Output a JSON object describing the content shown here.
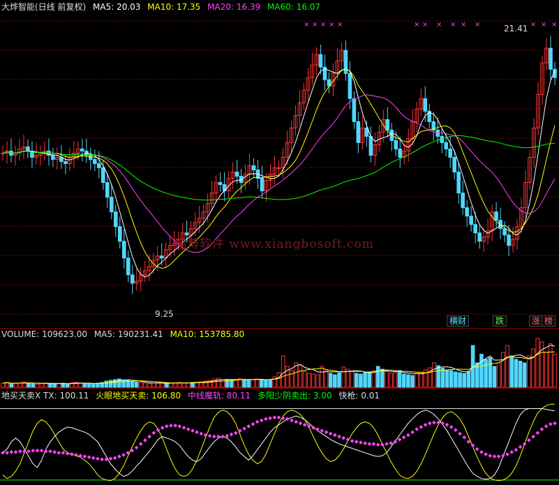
{
  "main_pane": {
    "title": "大烨智能(日线 前复权)",
    "ma_labels": [
      {
        "text": "MA5: 20.03",
        "color": "#ffffff"
      },
      {
        "text": "MA10: 17.35",
        "color": "#ffff00"
      },
      {
        "text": "MA20: 16.39",
        "color": "#ff44ff"
      },
      {
        "text": "MA60: 16.07",
        "color": "#00ff00"
      }
    ],
    "high_label": "21.41",
    "low_label": "9.25",
    "watermark": "翔博软件 www.xiangbosoft.com",
    "badges": [
      {
        "text": "横财",
        "color": "#4fd8ff"
      },
      {
        "text": "跌",
        "color": "#44ff44"
      },
      {
        "text": "涨",
        "color": "#ff6666"
      },
      {
        "text": "榜",
        "color": "#ff6666"
      }
    ]
  },
  "volume_pane": {
    "labels": [
      {
        "text": "VOLUME: 109623.00",
        "color": "#dddddd"
      },
      {
        "text": "MA5: 190231.41",
        "color": "#dddddd"
      },
      {
        "text": "MA10: 153785.80",
        "color": "#ffff00"
      }
    ]
  },
  "indicator_pane": {
    "labels": [
      {
        "text": "地买天卖X TX: 100.11",
        "color": "#dddddd"
      },
      {
        "text": "火眼地买天卖: 106.80",
        "color": "#ffff00"
      },
      {
        "text": "中线魔轨: 80.11",
        "color": "#ff44ff"
      },
      {
        "text": "多阳少阴卖出: 3.00",
        "color": "#00ff00"
      },
      {
        "text": "快枪: 0.01",
        "color": "#dddddd"
      }
    ]
  },
  "colors": {
    "up": "#ff3333",
    "down": "#4fd8ff",
    "ma5": "#ffffff",
    "ma10": "#ffff00",
    "ma20": "#ff44ff",
    "ma60": "#00ff00",
    "grid": "#8a0000"
  },
  "chart_data": [
    {
      "type": "candlestick",
      "title": "大烨智能(日线 前复权)",
      "ylim": [
        8.0,
        22.5
      ],
      "annotations": [
        "21.41",
        "9.25"
      ],
      "close": [
        16.0,
        16.1,
        15.9,
        16.0,
        16.2,
        16.3,
        16.1,
        15.8,
        15.9,
        16.0,
        16.1,
        15.9,
        15.7,
        15.8,
        15.6,
        15.5,
        15.8,
        16.0,
        16.2,
        16.1,
        15.9,
        15.7,
        15.5,
        15.3,
        14.6,
        13.9,
        13.2,
        12.5,
        11.8,
        11.0,
        10.2,
        9.8,
        9.9,
        10.2,
        10.4,
        10.6,
        10.9,
        11.1,
        11.0,
        11.4,
        11.6,
        11.7,
        11.9,
        12.2,
        12.1,
        12.4,
        12.7,
        12.9,
        13.2,
        13.6,
        14.1,
        14.6,
        14.5,
        14.2,
        14.8,
        15.1,
        14.9,
        14.6,
        15.0,
        15.4,
        15.2,
        14.8,
        14.2,
        14.7,
        15.0,
        15.3,
        15.3,
        15.8,
        16.5,
        17.2,
        17.8,
        18.4,
        19.0,
        19.6,
        20.2,
        20.7,
        20.1,
        19.5,
        19.2,
        19.8,
        20.4,
        20.9,
        19.8,
        18.6,
        17.5,
        16.5,
        17.2,
        16.8,
        15.9,
        16.4,
        17.0,
        17.6,
        17.1,
        16.6,
        16.2,
        15.8,
        16.1,
        16.7,
        17.5,
        18.1,
        18.6,
        18.0,
        17.5,
        17.1,
        16.8,
        16.5,
        16.2,
        15.8,
        15.1,
        14.1,
        13.4,
        13.0,
        12.6,
        12.2,
        11.8,
        12.0,
        12.3,
        13.2,
        12.8,
        12.4,
        12.1,
        11.6,
        11.9,
        12.5,
        13.4,
        14.6,
        15.8,
        17.2,
        18.8,
        20.3,
        21.0,
        20.0,
        19.6
      ],
      "ma_legend": {
        "MA5": 20.03,
        "MA10": 17.35,
        "MA20": 16.39,
        "MA60": 16.07
      }
    },
    {
      "type": "bar",
      "title": "VOLUME",
      "values": [
        12,
        14,
        10,
        11,
        13,
        15,
        12,
        10,
        9,
        11,
        12,
        10,
        9,
        11,
        12,
        10,
        13,
        14,
        12,
        11,
        10,
        9,
        12,
        14,
        18,
        20,
        22,
        24,
        21,
        19,
        17,
        15,
        13,
        12,
        11,
        12,
        13,
        12,
        11,
        12,
        13,
        14,
        12,
        13,
        14,
        15,
        16,
        18,
        20,
        24,
        26,
        22,
        21,
        20,
        22,
        25,
        23,
        20,
        22,
        24,
        23,
        21,
        22,
        30,
        42,
        90,
        60,
        48,
        70,
        62,
        45,
        40,
        38,
        36,
        60,
        48,
        40,
        36,
        42,
        58,
        52,
        46,
        40,
        38,
        42,
        44,
        48,
        60,
        52,
        45,
        40,
        42,
        48,
        38,
        36,
        34,
        40,
        44,
        50,
        56,
        70,
        62,
        55,
        50,
        48,
        44,
        42,
        40,
        46,
        120,
        70,
        95,
        80,
        85,
        60,
        70,
        100,
        120,
        90,
        80,
        75,
        70,
        90,
        110,
        140,
        130,
        100,
        125,
        95
      ],
      "ma_legend": {
        "MA5": 190231.41,
        "MA10": 153785.8
      },
      "last_volume": 109623.0
    },
    {
      "type": "line",
      "title": "地买天卖X",
      "series": [
        {
          "name": "TX",
          "values": [
            40,
            45,
            55,
            60,
            55,
            45,
            35,
            25,
            20,
            30,
            45,
            55,
            62,
            68,
            72,
            75,
            74,
            72,
            70,
            68,
            65,
            60,
            55,
            45,
            35,
            25,
            18,
            12,
            8,
            10,
            15,
            22,
            28,
            35,
            42,
            50,
            58,
            62,
            60,
            58,
            55,
            50,
            42,
            35,
            30,
            28,
            32,
            40,
            48,
            55,
            60,
            62,
            60,
            55,
            48,
            40,
            35,
            30,
            36,
            44,
            52,
            60,
            68,
            74,
            78,
            82,
            86,
            88,
            90,
            88,
            85,
            80,
            75,
            70,
            66,
            62,
            58,
            55,
            52,
            50,
            48,
            46,
            44,
            42,
            40,
            38,
            36,
            35,
            36,
            40,
            48,
            56,
            64,
            72,
            80,
            86,
            92,
            96,
            98,
            96,
            92,
            86,
            78,
            70,
            60,
            50,
            40,
            30,
            20,
            12,
            8,
            5,
            4,
            5,
            10,
            20,
            35,
            50,
            65,
            80,
            92,
            98,
            100,
            100,
            100,
            100,
            99,
            98,
            97
          ]
        },
        {
          "name": "火眼地买天卖",
          "values": [
            10,
            5,
            8,
            15,
            25,
            40,
            55,
            70,
            80,
            85,
            82,
            75,
            65,
            55,
            45,
            40,
            38,
            36,
            34,
            30,
            25,
            18,
            10,
            5,
            3,
            2,
            5,
            12,
            22,
            35,
            48,
            60,
            70,
            78,
            82,
            80,
            72,
            60,
            45,
            30,
            18,
            10,
            8,
            10,
            18,
            30,
            45,
            60,
            75,
            88,
            95,
            98,
            96,
            90,
            80,
            65,
            50,
            38,
            30,
            25,
            28,
            38,
            52,
            66,
            80,
            90,
            96,
            98,
            96,
            92,
            85,
            75,
            62,
            50,
            40,
            32,
            28,
            30,
            36,
            45,
            56,
            66,
            74,
            80,
            82,
            80,
            74,
            64,
            52,
            40,
            28,
            18,
            10,
            6,
            5,
            8,
            15,
            25,
            38,
            52,
            66,
            78,
            88,
            94,
            96,
            92,
            86,
            76,
            62,
            48,
            34,
            22,
            12,
            6,
            3,
            2,
            3,
            6,
            12,
            22,
            36,
            52,
            68,
            82,
            94,
            100,
            104,
            106,
            106
          ]
        },
        {
          "name": "中线魔轨",
          "values": [
            40,
            40,
            41,
            41,
            42,
            42,
            42,
            43,
            43,
            43,
            42,
            42,
            41,
            40,
            40,
            39,
            38,
            37,
            36,
            35,
            34,
            33,
            32,
            31,
            31,
            32,
            33,
            35,
            37,
            40,
            43,
            47,
            52,
            57,
            62,
            67,
            71,
            74,
            76,
            77,
            77,
            76,
            74,
            72,
            70,
            68,
            66,
            64,
            63,
            62,
            62,
            62,
            63,
            65,
            67,
            70,
            73,
            76,
            79,
            82,
            84,
            86,
            87,
            88,
            88,
            87,
            86,
            84,
            82,
            80,
            78,
            76,
            74,
            72,
            70,
            68,
            66,
            64,
            62,
            60,
            58,
            56,
            55,
            54,
            53,
            52,
            52,
            51,
            51,
            52,
            53,
            55,
            58,
            61,
            64,
            68,
            72,
            75,
            78,
            80,
            81,
            81,
            80,
            78,
            75,
            71,
            66,
            61,
            55,
            50,
            45,
            41,
            38,
            36,
            35,
            35,
            36,
            38,
            41,
            44,
            48,
            52,
            57,
            62,
            67,
            72,
            76,
            79,
            80
          ]
        }
      ],
      "ylim": [
        0,
        110
      ]
    }
  ]
}
